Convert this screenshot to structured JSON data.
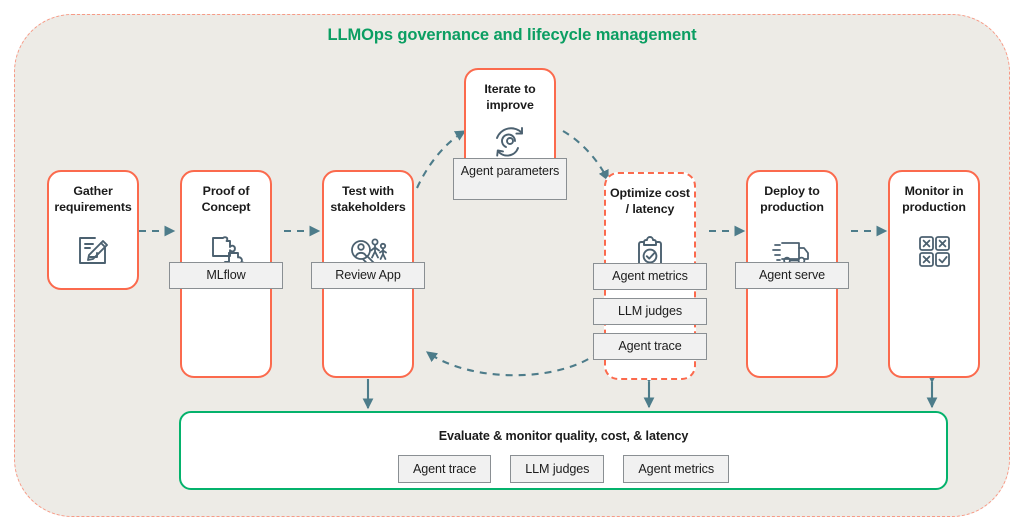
{
  "diagram": {
    "title": "LLMOps governance and lifecycle management",
    "colors": {
      "title_green": "#0b9e62",
      "stage_border_red": "#fb6a4d",
      "outer_dashed": "#f79a86",
      "outer_fill": "#edebe6",
      "eval_border_green": "#04b26c",
      "arrow_slate": "#4d7c8a",
      "icon_slate": "#4c6170",
      "tag_fill": "#f1f1f1",
      "tag_border": "#8a8f93"
    }
  },
  "stages": [
    {
      "id": "gather-requirements",
      "title": "Gather requirements",
      "icon": "document-pencil-icon",
      "border": "solid",
      "tags": []
    },
    {
      "id": "proof-of-concept",
      "title": "Proof of Concept",
      "icon": "puzzle-pieces-icon",
      "border": "solid",
      "tags": [
        "MLflow"
      ]
    },
    {
      "id": "test-with-stakeholders",
      "title": "Test with stakeholders",
      "icon": "users-review-icon",
      "border": "solid",
      "tags": [
        "Review App"
      ]
    },
    {
      "id": "iterate-to-improve",
      "title": "Iterate to improve",
      "icon": "circular-refresh-icon",
      "border": "solid",
      "tags": [
        "Agent parameters"
      ]
    },
    {
      "id": "optimize-cost-latency",
      "title": "Optimize cost / latency",
      "icon": "clipboard-check-icon",
      "border": "dashed",
      "tags": [
        "Agent metrics",
        "LLM judges",
        "Agent trace"
      ]
    },
    {
      "id": "deploy-to-production",
      "title": "Deploy to production",
      "icon": "delivery-truck-icon",
      "border": "solid",
      "tags": [
        "Agent serve"
      ]
    },
    {
      "id": "monitor-in-production",
      "title": "Monitor in production",
      "icon": "grid-check-icon",
      "border": "solid",
      "tags": []
    }
  ],
  "evaluate_bar": {
    "title": "Evaluate & monitor quality, cost, & latency",
    "tags": [
      "Agent trace",
      "LLM judges",
      "Agent metrics"
    ]
  }
}
